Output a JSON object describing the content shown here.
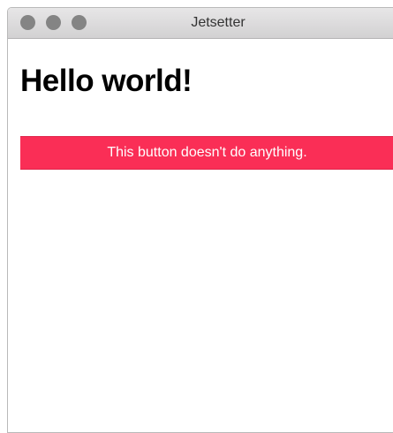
{
  "window": {
    "title": "Jetsetter",
    "controls": [
      {
        "name": "close",
        "icon": "traffic-light-close-icon"
      },
      {
        "name": "minimize",
        "icon": "traffic-light-minimize-icon"
      },
      {
        "name": "zoom",
        "icon": "traffic-light-zoom-icon"
      }
    ],
    "control_color": "#848484"
  },
  "main": {
    "heading": "Hello world!",
    "button_label": "This button doesn't do anything.",
    "button_color": "#fa2e56"
  }
}
